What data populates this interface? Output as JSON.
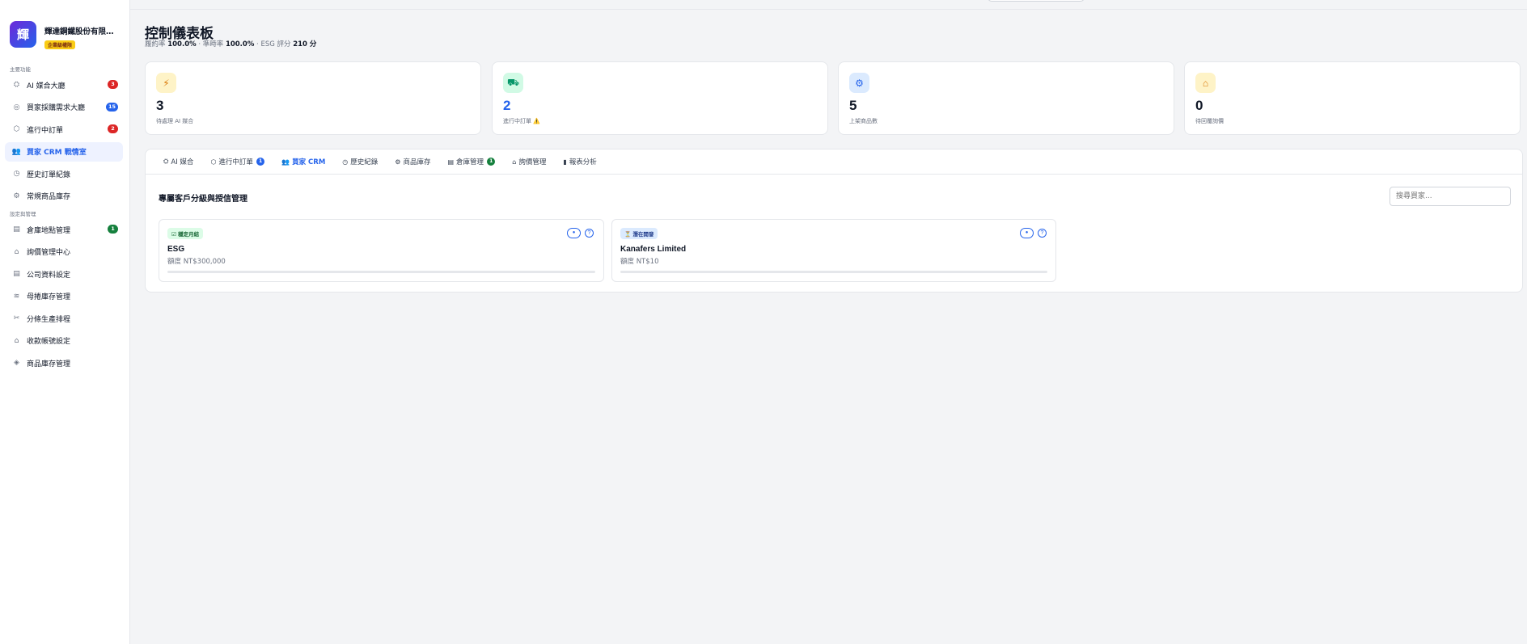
{
  "brand": {
    "logo_char": "輝",
    "name": "輝達鋼鐵股份有限公司",
    "badge": "企業級權限"
  },
  "sidebar": {
    "section_main": "主要功能",
    "main_items": [
      {
        "icon": "robot-icon",
        "label": "AI 媒合大廳",
        "badge": "3"
      },
      {
        "icon": "target-icon",
        "label": "買家採購需求大廳",
        "badge": "15"
      },
      {
        "icon": "box-icon",
        "label": "進行中訂單",
        "badge": "2"
      },
      {
        "icon": "users-icon",
        "label": "買家 CRM 戰情室",
        "badge": ""
      },
      {
        "icon": "history-icon",
        "label": "歷史訂單紀錄",
        "badge": ""
      },
      {
        "icon": "products-icon",
        "label": "常規商品庫存",
        "badge": ""
      }
    ],
    "section_settings": "設定與管理",
    "settings_items": [
      {
        "icon": "warehouse-doc-icon",
        "label": "倉庫地點管理",
        "badge": "1"
      },
      {
        "icon": "inbox-icon",
        "label": "詢價管理中心",
        "badge": ""
      },
      {
        "icon": "doc-icon",
        "label": "公司資料設定",
        "badge": ""
      },
      {
        "icon": "database-icon",
        "label": "母捲庫存管理",
        "badge": ""
      },
      {
        "icon": "scissors-icon",
        "label": "分條生產排程",
        "badge": ""
      },
      {
        "icon": "bank-icon",
        "label": "收款帳號設定",
        "badge": ""
      },
      {
        "icon": "package-icon",
        "label": "商品庫存管理",
        "badge": ""
      }
    ]
  },
  "header": {
    "title": "控制儀表板",
    "kpi_line": {
      "fulfil_label": "履約率",
      "fulfil_value": "100.0%",
      "sep1": "· 準時率",
      "ontime_value": "100.0%",
      "sep2": "· ESG 評分",
      "esg_value": "210 分"
    }
  },
  "stats": [
    {
      "icon": "lightning-icon",
      "icon_glyph": "⚡",
      "value": "3",
      "label": "待處理 AI 媒合",
      "accent": "#111827",
      "icon_bg": "#fef3c7"
    },
    {
      "icon": "truck-icon",
      "icon_glyph": "🚚",
      "value": "2",
      "label": "進行中訂單 ⚠️",
      "accent": "#2563eb",
      "icon_bg": "#d1fae5"
    },
    {
      "icon": "products-icon",
      "icon_glyph": "⚙",
      "value": "5",
      "label": "上架商品數",
      "accent": "#111827",
      "icon_bg": "#dbeafe"
    },
    {
      "icon": "inbox-icon",
      "icon_glyph": "📥",
      "value": "0",
      "label": "待回覆詢價",
      "accent": "#111827",
      "icon_bg": "#fef3c7"
    }
  ],
  "tabs": [
    {
      "icon": "robot-icon",
      "glyph": "⛭",
      "label": "AI 媒合",
      "badge": ""
    },
    {
      "icon": "box-icon",
      "glyph": "⬡",
      "label": "進行中訂單",
      "badge": "1"
    },
    {
      "icon": "users-icon",
      "glyph": "👥",
      "label": "買家 CRM",
      "badge": ""
    },
    {
      "icon": "history-icon",
      "glyph": "◷",
      "label": "歷史紀錄",
      "badge": ""
    },
    {
      "icon": "products-icon",
      "glyph": "⚙",
      "label": "商品庫存",
      "badge": ""
    },
    {
      "icon": "warehouse-doc-icon",
      "glyph": "▤",
      "label": "倉庫管理",
      "badge": "1"
    },
    {
      "icon": "inbox-icon",
      "glyph": "⌂",
      "label": "詢價管理",
      "badge": ""
    },
    {
      "icon": "chart-icon",
      "glyph": "▮",
      "label": "報表分析",
      "badge": ""
    }
  ],
  "crm": {
    "title": "專屬客戶分級與授信管理",
    "search_placeholder": "搜尋買家...",
    "customers": [
      {
        "tier": "☑ 穩定月結",
        "tier_color": "#166534",
        "tier_bg": "#dcfce7",
        "name": "ESG",
        "quota": "額度 NT$300,000"
      },
      {
        "tier": "⏳ 潛在開發",
        "tier_color": "#1e3a8a",
        "tier_bg": "#dbeafe",
        "name": "Kanafers Limited",
        "quota": "額度 NT$10"
      }
    ]
  },
  "colors": {
    "accent": "#2563eb",
    "badge_red": "#dc2626",
    "badge_blue": "#2563eb",
    "badge_green": "#15803d"
  }
}
